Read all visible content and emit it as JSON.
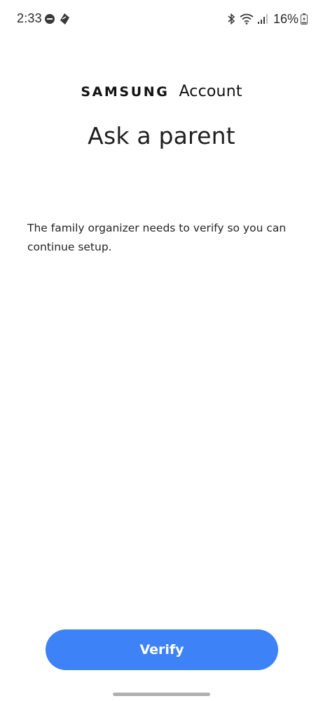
{
  "status_bar": {
    "time": "2:33",
    "battery_percent": "16%",
    "icons": [
      "do-not-disturb-icon",
      "app-notification-icon",
      "bluetooth-icon",
      "wifi-icon",
      "cell-signal-icon",
      "battery-charging-icon"
    ]
  },
  "header": {
    "brand": "SAMSUNG",
    "product": "Account",
    "title": "Ask a parent"
  },
  "body": {
    "message": "The family organizer needs to verify so you can continue setup."
  },
  "actions": {
    "verify_label": "Verify"
  },
  "colors": {
    "accent": "#3e82f7",
    "background": "#ffffff",
    "text": "#1f1f1f"
  }
}
